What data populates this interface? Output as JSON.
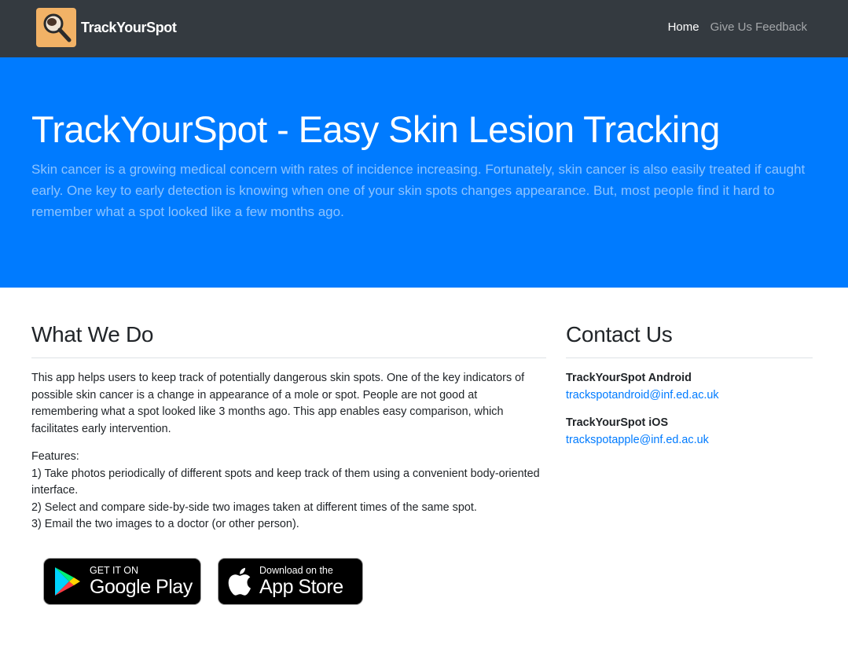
{
  "navbar": {
    "brand": "TrackYourSpot",
    "logo_icon": "magnifier-logo-icon",
    "links": [
      {
        "label": "Home",
        "active": true
      },
      {
        "label": "Give Us Feedback",
        "active": false
      }
    ]
  },
  "hero": {
    "title": "TrackYourSpot - Easy Skin Lesion Tracking",
    "description": "Skin cancer is a growing medical concern with rates of incidence increasing. Fortunately, skin cancer is also easily treated if caught early. One key to early detection is knowing when one of your skin spots changes appearance. But, most people find it hard to remember what a spot looked like a few months ago."
  },
  "what_we_do": {
    "heading": "What We Do",
    "intro": "This app helps users to keep track of potentially dangerous skin spots. One of the key indicators of possible skin cancer is a change in appearance of a mole or spot. People are not good at remembering what a spot looked like 3 months ago. This app enables easy comparison, which facilitates early intervention.",
    "features_label": "Features:",
    "features": [
      "1) Take photos periodically of different spots and keep track of them using a convenient body-oriented interface.",
      "2) Select and compare side-by-side two images taken at different times of the same spot.",
      "3) Email the two images to a doctor (or other person)."
    ]
  },
  "badges": {
    "google_play": {
      "small": "GET IT ON",
      "large": "Google Play",
      "icon": "google-play-icon"
    },
    "app_store": {
      "small": "Download on the",
      "large": "App Store",
      "icon": "apple-icon"
    }
  },
  "contact": {
    "heading": "Contact Us",
    "entries": [
      {
        "name": "TrackYourSpot Android",
        "email": "trackspotandroid@inf.ed.ac.uk"
      },
      {
        "name": "TrackYourSpot iOS",
        "email": "trackspotapple@inf.ed.ac.uk"
      }
    ]
  },
  "colors": {
    "navbar": "#343a40",
    "hero": "#007bff",
    "link": "#007bff",
    "logo_bg": "#f2b266"
  }
}
